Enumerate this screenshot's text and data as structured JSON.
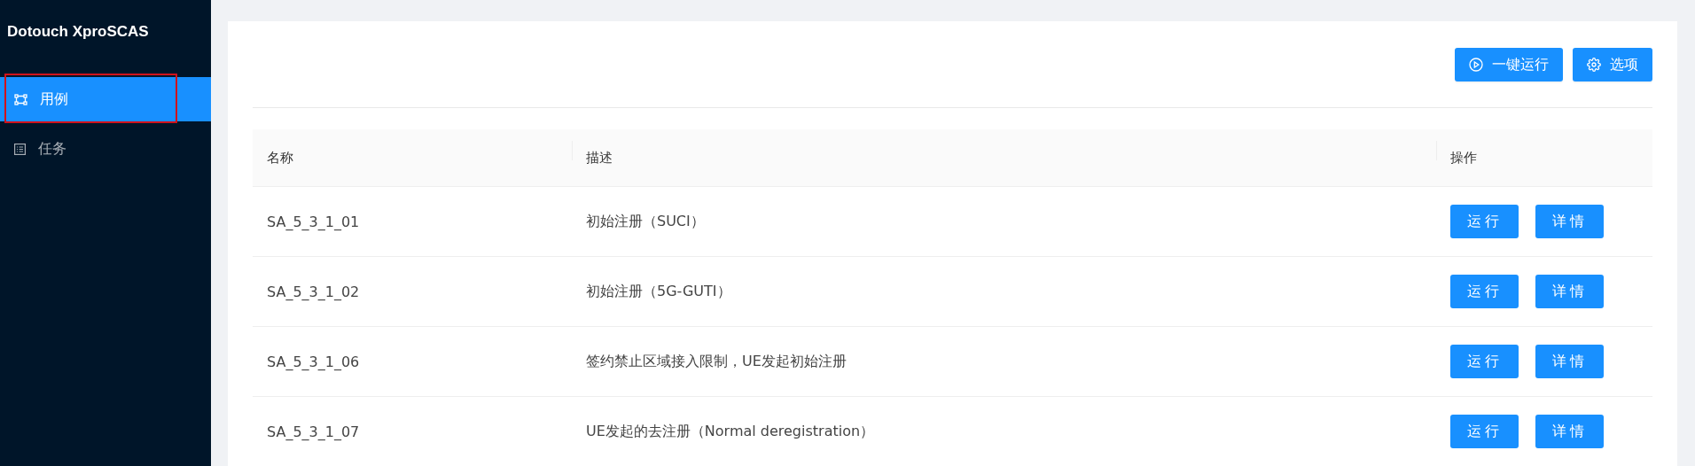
{
  "sidebar": {
    "logo": "Dotouch XproSCAS",
    "items": [
      {
        "label": "用例",
        "selected": true,
        "highlighted": true
      },
      {
        "label": "任务",
        "selected": false,
        "highlighted": false
      }
    ]
  },
  "toolbar": [
    {
      "label": "一键运行"
    },
    {
      "label": "选项"
    }
  ],
  "table": {
    "columns": [
      "名称",
      "描述",
      "操作"
    ],
    "rows": [
      {
        "name": "SA_5_3_1_01",
        "description": "初始注册（SUCI）",
        "actions": [
          "运行",
          "详情"
        ]
      },
      {
        "name": "SA_5_3_1_02",
        "description": "初始注册（5G-GUTI）",
        "actions": [
          "运行",
          "详情"
        ]
      },
      {
        "name": "SA_5_3_1_06",
        "description": "签约禁止区域接入限制，UE发起初始注册",
        "actions": [
          "运行",
          "详情"
        ]
      },
      {
        "name": "SA_5_3_1_07",
        "description": "UE发起的去注册（Normal deregistration）",
        "actions": [
          "运行",
          "详情"
        ]
      }
    ]
  }
}
